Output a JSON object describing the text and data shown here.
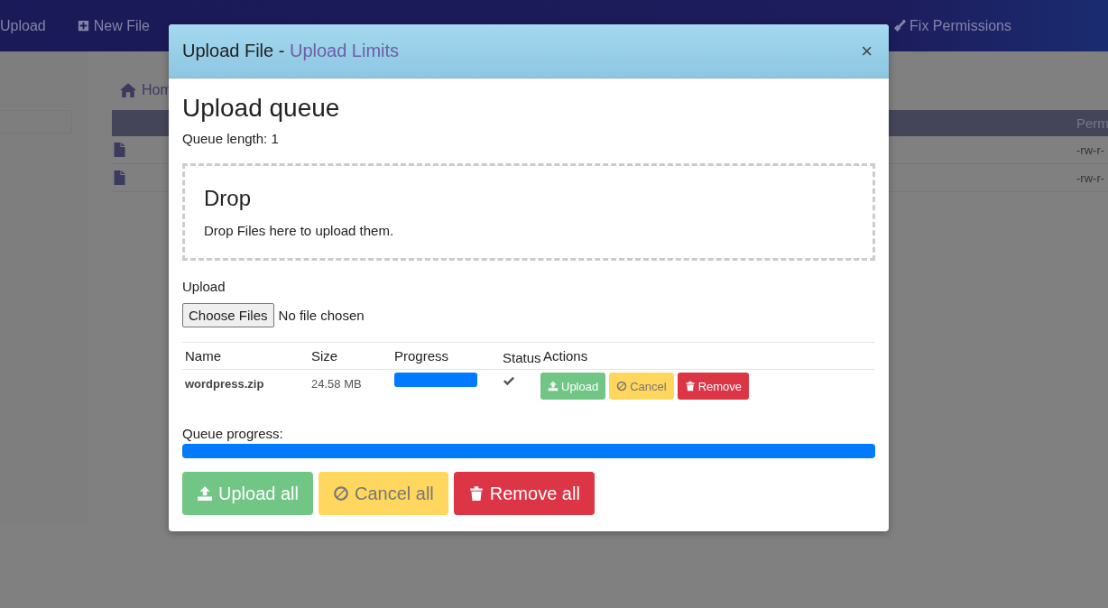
{
  "toolbar": [
    {
      "label": "Upload"
    },
    {
      "label": "New File"
    },
    {
      "label": "Fix Permissions"
    }
  ],
  "breadcrumb": "Hom",
  "file_table": {
    "columns": [
      "Perm"
    ],
    "rows": [
      {
        "permissions": "-rw-r-"
      },
      {
        "permissions": "-rw-r-"
      }
    ]
  },
  "modal": {
    "title": "Upload File - ",
    "title_link": "Upload Limits",
    "close": "×",
    "heading": "Upload queue",
    "queue_length": "Queue length: 1",
    "drop": {
      "title": "Drop",
      "text": "Drop Files here to upload them."
    },
    "upload_label": "Upload",
    "choose_button": "Choose Files",
    "no_file": "No file chosen",
    "queue": {
      "columns": [
        "Name",
        "Size",
        "Progress",
        "Status",
        "Actions"
      ],
      "rows": [
        {
          "name": "wordpress.zip",
          "size": "24.58 MB",
          "level": 1,
          "done": true,
          "actions": [
            {
              "kind": "upload",
              "label": "Upload"
            },
            {
              "kind": "cancel",
              "label": "Cancel"
            },
            {
              "kind": "remove",
              "label": "Remove"
            }
          ]
        }
      ]
    },
    "queue_progress": {
      "label": "Queue progress:",
      "level": 1
    },
    "buttons": [
      {
        "kind": "upload",
        "label": "Upload all"
      },
      {
        "kind": "cancel",
        "label": "Cancel all"
      },
      {
        "kind": "remove",
        "label": "Remove all"
      }
    ]
  }
}
